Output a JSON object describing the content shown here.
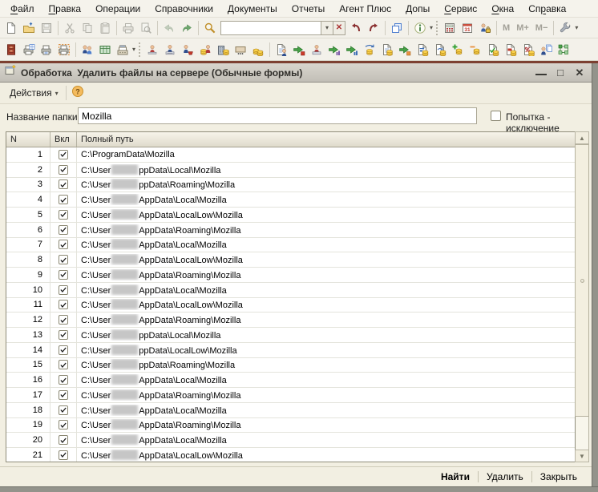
{
  "colors": {
    "maroon_bar": "#7C4031",
    "cream": "#F2EFE2",
    "titlebar_gray": "#CBC8C0",
    "coin_gold": "#FBD34D"
  },
  "menubar": {
    "items": [
      {
        "label": "Файл",
        "u": 0
      },
      {
        "label": "Правка",
        "u": 0
      },
      {
        "label": "Операции",
        "u": -1
      },
      {
        "label": "Справочники",
        "u": -1
      },
      {
        "label": "Документы",
        "u": 0
      },
      {
        "label": "Отчеты",
        "u": -1
      },
      {
        "label": "Агент Плюс",
        "u": -1
      },
      {
        "label": "Допы",
        "u": 0
      },
      {
        "label": "Сервис",
        "u": 0
      },
      {
        "label": "Окна",
        "u": 0
      },
      {
        "label": "Справка",
        "u": 2
      }
    ]
  },
  "toolbar_main": {
    "items": [
      {
        "type": "icon",
        "name": "new-document"
      },
      {
        "type": "icon",
        "name": "open-folder"
      },
      {
        "type": "icon",
        "name": "save",
        "disabled": true
      },
      {
        "type": "sep"
      },
      {
        "type": "icon",
        "name": "cut",
        "disabled": true
      },
      {
        "type": "icon",
        "name": "copy",
        "disabled": true
      },
      {
        "type": "icon",
        "name": "paste",
        "disabled": true
      },
      {
        "type": "sep"
      },
      {
        "type": "icon",
        "name": "print",
        "disabled": true
      },
      {
        "type": "icon",
        "name": "print-preview",
        "disabled": true
      },
      {
        "type": "sep"
      },
      {
        "type": "icon",
        "name": "undo",
        "disabled": true
      },
      {
        "type": "icon",
        "name": "redo"
      },
      {
        "type": "sep"
      },
      {
        "type": "icon",
        "name": "find"
      },
      {
        "type": "search",
        "value": "",
        "placeholder": ""
      },
      {
        "type": "icon",
        "name": "find-previous"
      },
      {
        "type": "icon",
        "name": "find-next"
      },
      {
        "type": "sep"
      },
      {
        "type": "icon",
        "name": "window-copy"
      },
      {
        "type": "sep"
      },
      {
        "type": "icon",
        "name": "info",
        "dropdown": true
      },
      {
        "type": "dots"
      },
      {
        "type": "icon",
        "name": "calculator"
      },
      {
        "type": "icon",
        "name": "calendar"
      },
      {
        "type": "icon",
        "name": "user-permissions"
      },
      {
        "type": "sep"
      },
      {
        "type": "text",
        "label": "M"
      },
      {
        "type": "text",
        "label": "M+"
      },
      {
        "type": "text",
        "label": "M−"
      },
      {
        "type": "sep"
      },
      {
        "type": "icon",
        "name": "service-settings",
        "dropdown": true
      }
    ]
  },
  "toolbar_custom": {
    "items": [
      {
        "type": "icon",
        "name": "archive-cabinet"
      },
      {
        "type": "icon",
        "name": "print-table"
      },
      {
        "type": "icon",
        "name": "print-document"
      },
      {
        "type": "icon",
        "name": "print-dashed"
      },
      {
        "type": "sep"
      },
      {
        "type": "icon",
        "name": "employees"
      },
      {
        "type": "icon",
        "name": "payroll-table"
      },
      {
        "type": "icon",
        "name": "cash-register",
        "dropdown": true
      },
      {
        "type": "dots"
      },
      {
        "type": "icon",
        "name": "person-red"
      },
      {
        "type": "icon",
        "name": "person-typing"
      },
      {
        "type": "icon",
        "name": "person-cart"
      },
      {
        "type": "icon",
        "name": "coins-person"
      },
      {
        "type": "icon",
        "name": "building-coins"
      },
      {
        "type": "icon",
        "name": "brick-ellipsis"
      },
      {
        "type": "icon",
        "name": "coins-stack"
      },
      {
        "type": "sep"
      },
      {
        "type": "icon",
        "name": "document-person"
      },
      {
        "type": "icon",
        "name": "upload-cube"
      },
      {
        "type": "icon",
        "name": "person-keyboard"
      },
      {
        "type": "icon",
        "name": "upload-purple"
      },
      {
        "type": "icon",
        "name": "upload-blue"
      },
      {
        "type": "icon",
        "name": "coins-refresh"
      },
      {
        "type": "icon",
        "name": "document-coins"
      },
      {
        "type": "icon",
        "name": "upload-orange"
      },
      {
        "type": "icon",
        "name": "doc-transfer-coins"
      },
      {
        "type": "icon",
        "name": "doc-refresh-coins"
      },
      {
        "type": "icon",
        "name": "coins-add"
      },
      {
        "type": "icon",
        "name": "coins-subtract"
      },
      {
        "type": "icon",
        "name": "doc-check-coins"
      },
      {
        "type": "icon",
        "name": "doc-coins-red"
      },
      {
        "type": "icon",
        "name": "doc-percent-coins"
      },
      {
        "type": "icon",
        "name": "person-documents"
      },
      {
        "type": "icon",
        "name": "structure-grid"
      }
    ]
  },
  "window": {
    "title": "Обработка  Удалить файлы на сервере (Обычные формы)",
    "controls": {
      "minimize": "_",
      "maximize": "□",
      "close": "✕"
    },
    "actions_menu": {
      "label": "Действия",
      "caret": "▾"
    },
    "folder_field": {
      "label": "Название папки:",
      "value": "Mozilla"
    },
    "exception_checkbox": {
      "label": "Попытка - исключение",
      "checked": false
    },
    "footer_buttons": [
      {
        "label": "Найти",
        "bold": true
      },
      {
        "label": "Удалить",
        "bold": false
      },
      {
        "label": "Закрыть",
        "bold": false
      }
    ]
  },
  "table": {
    "columns": [
      "N",
      "Вкл",
      "Полный путь"
    ],
    "rows": [
      {
        "n": 1,
        "checked": true,
        "path_prefix": "C:\\ProgramData\\Mozilla",
        "redacted": false,
        "path_suffix": ""
      },
      {
        "n": 2,
        "checked": true,
        "path_prefix": "C:\\User",
        "redacted": true,
        "path_suffix": "ppData\\Local\\Mozilla"
      },
      {
        "n": 3,
        "checked": true,
        "path_prefix": "C:\\User",
        "redacted": true,
        "path_suffix": "ppData\\Roaming\\Mozilla"
      },
      {
        "n": 4,
        "checked": true,
        "path_prefix": "C:\\User",
        "redacted": true,
        "path_suffix": "AppData\\Local\\Mozilla"
      },
      {
        "n": 5,
        "checked": true,
        "path_prefix": "C:\\User",
        "redacted": true,
        "path_suffix": "AppData\\LocalLow\\Mozilla"
      },
      {
        "n": 6,
        "checked": true,
        "path_prefix": "C:\\User",
        "redacted": true,
        "path_suffix": "AppData\\Roaming\\Mozilla"
      },
      {
        "n": 7,
        "checked": true,
        "path_prefix": "C:\\User",
        "redacted": true,
        "path_suffix": "AppData\\Local\\Mozilla"
      },
      {
        "n": 8,
        "checked": true,
        "path_prefix": "C:\\User",
        "redacted": true,
        "path_suffix": "AppData\\LocalLow\\Mozilla"
      },
      {
        "n": 9,
        "checked": true,
        "path_prefix": "C:\\User",
        "redacted": true,
        "path_suffix": "AppData\\Roaming\\Mozilla"
      },
      {
        "n": 10,
        "checked": true,
        "path_prefix": "C:\\User",
        "redacted": true,
        "path_suffix": "AppData\\Local\\Mozilla"
      },
      {
        "n": 11,
        "checked": true,
        "path_prefix": "C:\\User",
        "redacted": true,
        "path_suffix": "AppData\\LocalLow\\Mozilla"
      },
      {
        "n": 12,
        "checked": true,
        "path_prefix": "C:\\User",
        "redacted": true,
        "path_suffix": "AppData\\Roaming\\Mozilla"
      },
      {
        "n": 13,
        "checked": true,
        "path_prefix": "C:\\User",
        "redacted": true,
        "path_suffix": "ppData\\Local\\Mozilla"
      },
      {
        "n": 14,
        "checked": true,
        "path_prefix": "C:\\User",
        "redacted": true,
        "path_suffix": "ppData\\LocalLow\\Mozilla"
      },
      {
        "n": 15,
        "checked": true,
        "path_prefix": "C:\\User",
        "redacted": true,
        "path_suffix": "ppData\\Roaming\\Mozilla"
      },
      {
        "n": 16,
        "checked": true,
        "path_prefix": "C:\\User",
        "redacted": true,
        "path_suffix": "AppData\\Local\\Mozilla"
      },
      {
        "n": 17,
        "checked": true,
        "path_prefix": "C:\\User",
        "redacted": true,
        "path_suffix": "AppData\\Roaming\\Mozilla"
      },
      {
        "n": 18,
        "checked": true,
        "path_prefix": "C:\\User",
        "redacted": true,
        "path_suffix": "AppData\\Local\\Mozilla"
      },
      {
        "n": 19,
        "checked": true,
        "path_prefix": "C:\\User",
        "redacted": true,
        "path_suffix": "AppData\\Roaming\\Mozilla"
      },
      {
        "n": 20,
        "checked": true,
        "path_prefix": "C:\\User",
        "redacted": true,
        "path_suffix": "AppData\\Local\\Mozilla"
      },
      {
        "n": 21,
        "checked": true,
        "path_prefix": "C:\\User",
        "redacted": true,
        "path_suffix": "AppData\\LocalLow\\Mozilla"
      }
    ]
  }
}
